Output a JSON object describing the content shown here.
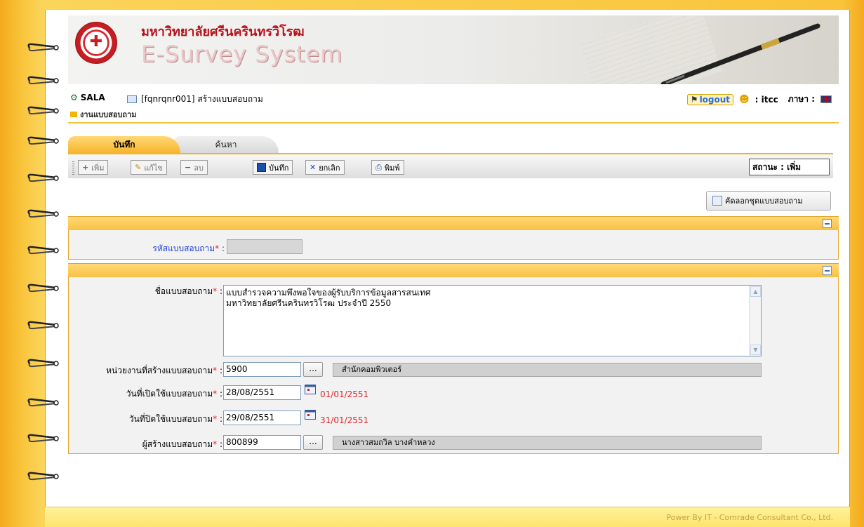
{
  "banner": {
    "university": "มหาวิทยาลัยศรีนครินทรวิโรฒ",
    "system": "E-Survey System"
  },
  "header": {
    "app": "SALA",
    "page_id": "[fqnrqnr001] สร้างแบบสอบถาม",
    "breadcrumb": "งานแบบสอบถาม",
    "logout": "logout",
    "user": ": itcc",
    "language_label": "ภาษา :"
  },
  "tabs": [
    {
      "label": "บันทึก",
      "active": true
    },
    {
      "label": "ค้นหา",
      "active": false
    }
  ],
  "toolbar": {
    "add": "เพิ่ม",
    "edit": "แก้ไข",
    "delete": "ลบ",
    "save": "บันทึก",
    "cancel": "ยกเลิก",
    "print": "พิมพ์",
    "status": "สถานะ : เพิ่ม"
  },
  "copy_button": "คัดลอกชุดแบบสอบถาม",
  "form": {
    "code": {
      "label": "รหัสแบบสอบถาม",
      "value": ""
    },
    "name": {
      "label": "ชื่อแบบสอบถาม",
      "line1": "แบบสำรวจความพึงพอใจของผู้รับบริการข้อมูลสารสนเทศ",
      "line2": "มหาวิทยาลัยศรีนครินทรวิโรฒ ประจำปี 2550"
    },
    "unit": {
      "label": "หน่วยงานที่สร้างแบบสอบถาม",
      "value": "5900",
      "name": "สำนักคอมพิวเตอร์"
    },
    "open_date": {
      "label": "วันที่เปิดใช้แบบสอบถาม",
      "value": "28/08/2551",
      "hint": "01/01/2551"
    },
    "close_date": {
      "label": "วันที่ปิดใช้แบบสอบถาม",
      "value": "29/08/2551",
      "hint": "31/01/2551"
    },
    "creator": {
      "label": "ผู้สร้างแบบสอบถาม",
      "value": "800899",
      "name": "นางสาวสมถวิล บางคำหลวง"
    },
    "required_mark": "*",
    "colon": " :"
  },
  "footer": "Power By IT - Comrade Consultant Co., Ltd.",
  "colors": {
    "accent": "#f7b932",
    "required": "#e0242b",
    "link": "#1c3fd0"
  }
}
